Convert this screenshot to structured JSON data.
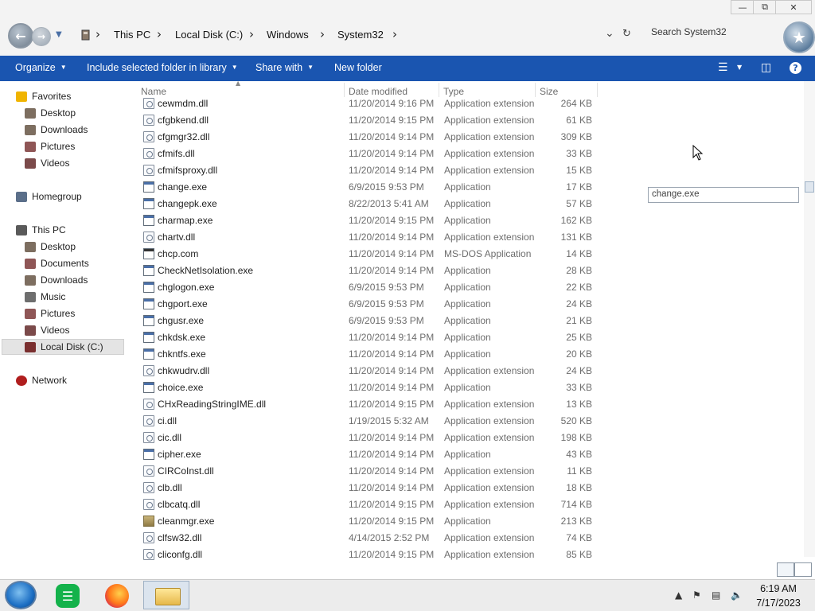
{
  "caption": {
    "minimize": "—",
    "maximize": "⧉",
    "close": "✕"
  },
  "address": {
    "crumbs": [
      "This PC",
      "Windows",
      "System32"
    ],
    "drive_crumb": "Local Disk (C:)",
    "search_placeholder": "Search System32"
  },
  "toolbar": {
    "organize": "Organize",
    "include": "Include selected folder in library",
    "share": "Share with",
    "new_folder": "New folder"
  },
  "nav": {
    "favorites": "Favorites",
    "fav_items": [
      "Desktop",
      "Downloads",
      "Pictures",
      "Videos"
    ],
    "homegroup": "Homegroup",
    "this_pc": "This PC",
    "pc_items": [
      "Desktop",
      "Documents",
      "Downloads",
      "Music",
      "Pictures",
      "Videos",
      "Local Disk (C:)"
    ],
    "network": "Network"
  },
  "columns": {
    "name": "Name",
    "date": "Date modified",
    "type": "Type",
    "size": "Size"
  },
  "files": [
    {
      "name": "cewmdm.dll",
      "date": "11/20/2014 9:16 PM",
      "type": "Application extension",
      "size": "264 KB",
      "icon": "dll"
    },
    {
      "name": "cfgbkend.dll",
      "date": "11/20/2014 9:15 PM",
      "type": "Application extension",
      "size": "61 KB",
      "icon": "dll"
    },
    {
      "name": "cfgmgr32.dll",
      "date": "11/20/2014 9:14 PM",
      "type": "Application extension",
      "size": "309 KB",
      "icon": "dll"
    },
    {
      "name": "cfmifs.dll",
      "date": "11/20/2014 9:14 PM",
      "type": "Application extension",
      "size": "33 KB",
      "icon": "dll"
    },
    {
      "name": "cfmifsproxy.dll",
      "date": "11/20/2014 9:14 PM",
      "type": "Application extension",
      "size": "15 KB",
      "icon": "dll"
    },
    {
      "name": "change.exe",
      "date": "6/9/2015 9:53 PM",
      "type": "Application",
      "size": "17 KB",
      "icon": "exe"
    },
    {
      "name": "changepk.exe",
      "date": "8/22/2013 5:41 AM",
      "type": "Application",
      "size": "57 KB",
      "icon": "exe"
    },
    {
      "name": "charmap.exe",
      "date": "11/20/2014 9:15 PM",
      "type": "Application",
      "size": "162 KB",
      "icon": "exe"
    },
    {
      "name": "chartv.dll",
      "date": "11/20/2014 9:14 PM",
      "type": "Application extension",
      "size": "131 KB",
      "icon": "dll"
    },
    {
      "name": "chcp.com",
      "date": "11/20/2014 9:14 PM",
      "type": "MS-DOS Application",
      "size": "14 KB",
      "icon": "com"
    },
    {
      "name": "CheckNetIsolation.exe",
      "date": "11/20/2014 9:14 PM",
      "type": "Application",
      "size": "28 KB",
      "icon": "exe"
    },
    {
      "name": "chglogon.exe",
      "date": "6/9/2015 9:53 PM",
      "type": "Application",
      "size": "22 KB",
      "icon": "exe"
    },
    {
      "name": "chgport.exe",
      "date": "6/9/2015 9:53 PM",
      "type": "Application",
      "size": "24 KB",
      "icon": "exe"
    },
    {
      "name": "chgusr.exe",
      "date": "6/9/2015 9:53 PM",
      "type": "Application",
      "size": "21 KB",
      "icon": "exe"
    },
    {
      "name": "chkdsk.exe",
      "date": "11/20/2014 9:14 PM",
      "type": "Application",
      "size": "25 KB",
      "icon": "exe"
    },
    {
      "name": "chkntfs.exe",
      "date": "11/20/2014 9:14 PM",
      "type": "Application",
      "size": "20 KB",
      "icon": "exe"
    },
    {
      "name": "chkwudrv.dll",
      "date": "11/20/2014 9:14 PM",
      "type": "Application extension",
      "size": "24 KB",
      "icon": "dll"
    },
    {
      "name": "choice.exe",
      "date": "11/20/2014 9:14 PM",
      "type": "Application",
      "size": "33 KB",
      "icon": "exe"
    },
    {
      "name": "CHxReadingStringIME.dll",
      "date": "11/20/2014 9:15 PM",
      "type": "Application extension",
      "size": "13 KB",
      "icon": "dll"
    },
    {
      "name": "ci.dll",
      "date": "1/19/2015 5:32 AM",
      "type": "Application extension",
      "size": "520 KB",
      "icon": "dll"
    },
    {
      "name": "cic.dll",
      "date": "11/20/2014 9:14 PM",
      "type": "Application extension",
      "size": "198 KB",
      "icon": "dll"
    },
    {
      "name": "cipher.exe",
      "date": "11/20/2014 9:14 PM",
      "type": "Application",
      "size": "43 KB",
      "icon": "exe"
    },
    {
      "name": "CIRCoInst.dll",
      "date": "11/20/2014 9:14 PM",
      "type": "Application extension",
      "size": "11 KB",
      "icon": "dll"
    },
    {
      "name": "clb.dll",
      "date": "11/20/2014 9:14 PM",
      "type": "Application extension",
      "size": "18 KB",
      "icon": "dll"
    },
    {
      "name": "clbcatq.dll",
      "date": "11/20/2014 9:15 PM",
      "type": "Application extension",
      "size": "714 KB",
      "icon": "dll"
    },
    {
      "name": "cleanmgr.exe",
      "date": "11/20/2014 9:15 PM",
      "type": "Application",
      "size": "213 KB",
      "icon": "cln"
    },
    {
      "name": "clfsw32.dll",
      "date": "4/14/2015 2:52 PM",
      "type": "Application extension",
      "size": "74 KB",
      "icon": "dll"
    },
    {
      "name": "cliconfg.dll",
      "date": "11/20/2014 9:15 PM",
      "type": "Application extension",
      "size": "85 KB",
      "icon": "dll"
    }
  ],
  "rename_value": "change.exe",
  "clock": {
    "time": "6:19 AM",
    "date": "7/17/2023"
  },
  "colors": {
    "command_bar": "#1a55b0",
    "selection": "#e4e4e4"
  }
}
